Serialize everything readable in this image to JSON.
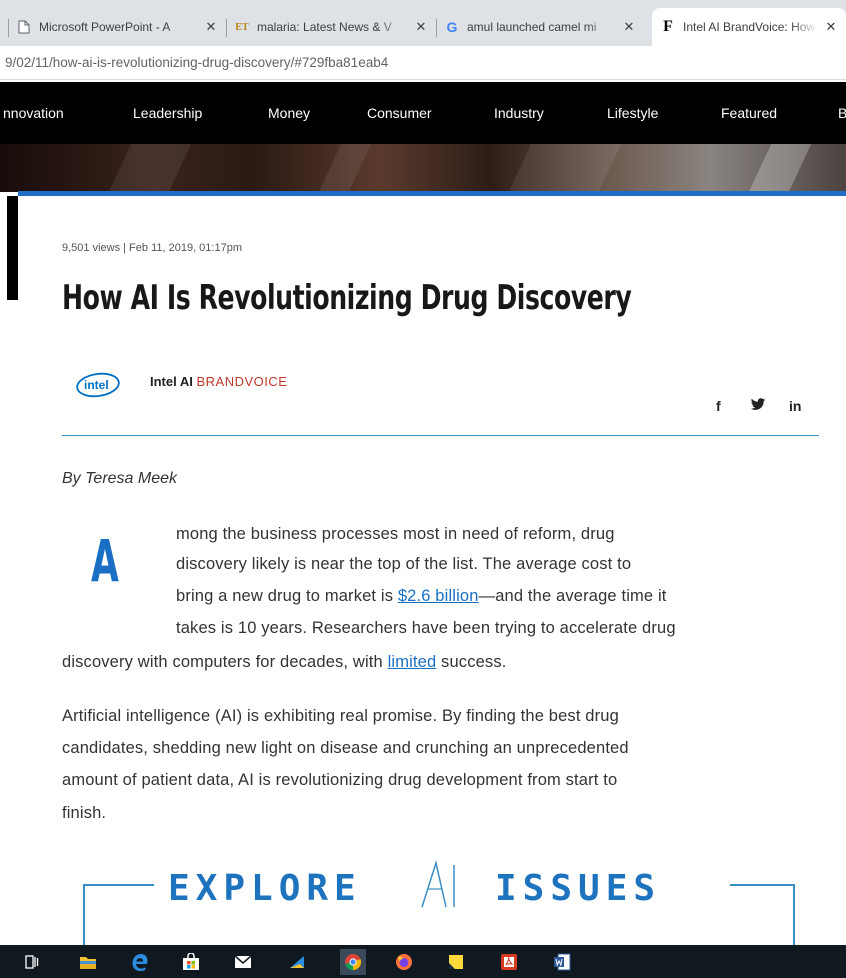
{
  "browser": {
    "tabs": [
      {
        "title": "Microsoft PowerPoint - A",
        "favicon": "document-icon",
        "active": false
      },
      {
        "title": "malaria: Latest News & V",
        "favicon": "et-icon",
        "favicon_text": "ET",
        "active": false
      },
      {
        "title": "amul launched camel mi",
        "favicon": "google-icon",
        "favicon_text": "G",
        "active": false
      },
      {
        "title": "Intel AI BrandVoice: How",
        "favicon": "forbes-icon",
        "favicon_text": "F",
        "active": true
      }
    ],
    "close_glyph": "✕",
    "url": "9/02/11/how-ai-is-revolutionizing-drug-discovery/#729fba81eab4"
  },
  "site_nav": {
    "items": [
      "nnovation",
      "Leadership",
      "Money",
      "Consumer",
      "Industry",
      "Lifestyle",
      "Featured",
      "B"
    ]
  },
  "article": {
    "meta": "9,501 views  |  Feb 11, 2019, 01:17pm",
    "headline": "How AI Is Revolutionizing Drug Discovery",
    "logo_text": "intel",
    "author_name": "Intel AI",
    "author_tag": "BRANDVOICE",
    "social": {
      "facebook": "f",
      "twitter": "𝕪",
      "linkedin": "in"
    },
    "byline": "By Teresa Meek",
    "dropcap": "A",
    "p1": {
      "l1": "mong the business processes most in need of reform, drug",
      "l2": "discovery likely is near the top of the list. The average cost to",
      "l3_before": "bring a new drug to market is ",
      "l3_link": "$2.6 billion",
      "l3_after": "—and the average time it",
      "l4": "takes is 10 years. Researchers have been trying to accelerate drug",
      "l5_before": "discovery with computers for decades, with ",
      "l5_link": "limited",
      "l5_after": " success."
    },
    "p2": {
      "l1": "Artificial intelligence (AI) is exhibiting real promise. By finding the best drug",
      "l2": "candidates, shedding new light on disease and crunching an unprecedented",
      "l3": "amount of patient data, AI is revolutionizing drug development from start to",
      "l4": "finish."
    },
    "explore": {
      "left": "EXPLORE",
      "right": "ISSUES"
    }
  },
  "colors": {
    "accent": "#1a6fc4",
    "brandvoice": "#c0392b",
    "nav_bg": "#000000",
    "taskbar_bg": "#101820"
  }
}
